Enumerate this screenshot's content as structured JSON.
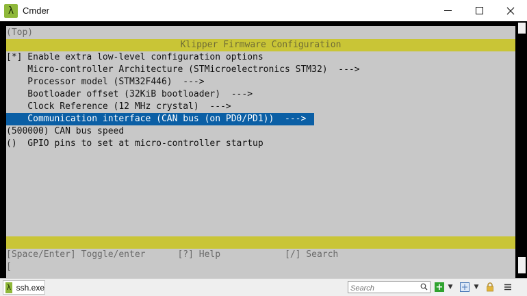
{
  "window": {
    "title": "Cmder",
    "app_icon_glyph": "λ"
  },
  "terminal": {
    "top_indicator": "(Top)",
    "header_title": "Klipper Firmware Configuration",
    "menu_items": [
      "[*] Enable extra low-level configuration options",
      "    Micro-controller Architecture (STMicroelectronics STM32)  --->",
      "    Processor model (STM32F446)  --->",
      "    Bootloader offset (32KiB bootloader)  --->",
      "    Clock Reference (12 MHz crystal)  --->",
      "    Communication interface (CAN bus (on PD0/PD1))  --->",
      "(500000) CAN bus speed",
      "()  GPIO pins to set at micro-controller startup"
    ],
    "selected_index": 5,
    "footer_help": "[Space/Enter] Toggle/enter      [?] Help            [/] Search",
    "prompt": "["
  },
  "statusbar": {
    "tab_label": "ssh.exe",
    "search_placeholder": "Search"
  },
  "colors": {
    "accent_yellow": "#c9c536",
    "selection_blue": "#0b5fa5",
    "terminal_bg": "#c8c8c8",
    "icon_green": "#8fb83a"
  },
  "icons": [
    "lambda-icon",
    "minimize-icon",
    "maximize-icon",
    "close-icon",
    "search-icon",
    "plus-icon",
    "chevron-down-icon",
    "split-icon",
    "lock-icon",
    "menu-icon"
  ]
}
